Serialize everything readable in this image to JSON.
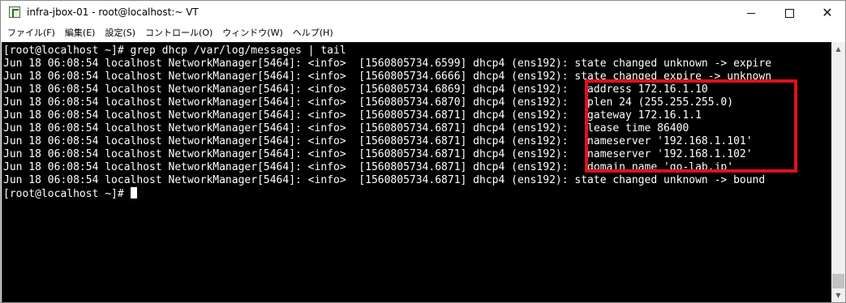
{
  "window": {
    "title": "infra-jbox-01 - root@localhost:~ VT",
    "minimize_symbol": "",
    "close_symbol": "✕"
  },
  "menu": [
    {
      "label": "ファイル(F)"
    },
    {
      "label": "編集(E)"
    },
    {
      "label": "設定(S)"
    },
    {
      "label": "コントロール(O)"
    },
    {
      "label": "ウィンドウ(W)"
    },
    {
      "label": "ヘルプ(H)"
    }
  ],
  "terminal": {
    "lines": [
      "[root@localhost ~]# grep dhcp /var/log/messages | tail",
      "Jun 18 06:08:54 localhost NetworkManager[5464]: <info>  [1560805734.6599] dhcp4 (ens192): state changed unknown -> expire",
      "Jun 18 06:08:54 localhost NetworkManager[5464]: <info>  [1560805734.6666] dhcp4 (ens192): state changed expire -> unknown",
      "Jun 18 06:08:54 localhost NetworkManager[5464]: <info>  [1560805734.6869] dhcp4 (ens192):   address 172.16.1.10",
      "Jun 18 06:08:54 localhost NetworkManager[5464]: <info>  [1560805734.6870] dhcp4 (ens192):   plen 24 (255.255.255.0)",
      "Jun 18 06:08:54 localhost NetworkManager[5464]: <info>  [1560805734.6871] dhcp4 (ens192):   gateway 172.16.1.1",
      "Jun 18 06:08:54 localhost NetworkManager[5464]: <info>  [1560805734.6871] dhcp4 (ens192):   lease time 86400",
      "Jun 18 06:08:54 localhost NetworkManager[5464]: <info>  [1560805734.6871] dhcp4 (ens192):   nameserver '192.168.1.101'",
      "Jun 18 06:08:54 localhost NetworkManager[5464]: <info>  [1560805734.6871] dhcp4 (ens192):   nameserver '192.168.1.102'",
      "Jun 18 06:08:54 localhost NetworkManager[5464]: <info>  [1560805734.6871] dhcp4 (ens192):   domain name 'go-lab.jp'",
      "Jun 18 06:08:54 localhost NetworkManager[5464]: <info>  [1560805734.6871] dhcp4 (ens192): state changed unknown -> bound"
    ],
    "prompt": "[root@localhost ~]# "
  },
  "colors": {
    "terminal_background": "#000000",
    "terminal_text": "#ffffff",
    "highlight": "#e0101c"
  }
}
